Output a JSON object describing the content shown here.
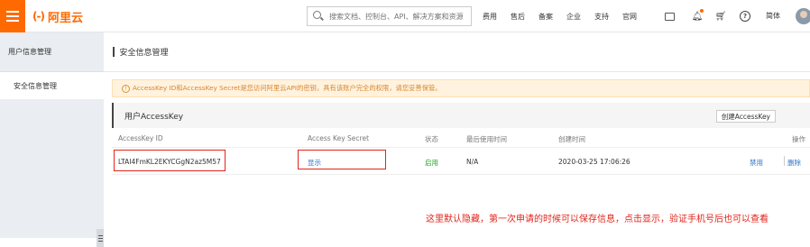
{
  "topbar": {
    "brand": "阿里云",
    "brand_mark": "(-)",
    "search_placeholder": "搜索文档、控制台、API、解决方案和资源",
    "nav": [
      "费用",
      "售后",
      "备案",
      "企业",
      "支持",
      "官网"
    ],
    "lang": "简体",
    "icons": [
      "menu-icon",
      "search-icon",
      "message-icon",
      "bell-icon",
      "cart-icon",
      "help-icon"
    ],
    "accent": "#ff6a00"
  },
  "sidebar": {
    "title": "用户信息管理",
    "items": [
      {
        "label": "安全信息管理",
        "active": true
      }
    ]
  },
  "main": {
    "page_title": "安全信息管理",
    "warning": "AccessKey ID和AccessKey Secret是您访问阿里云API的密钥，具有该账户完全的权限，请您妥善保管。",
    "panel_title": "用户AccessKey",
    "create_button": "创建AccessKey",
    "columns": [
      "AccessKey ID",
      "Access Key Secret",
      "状态",
      "最后使用时间",
      "创建时间",
      "操作"
    ],
    "rows": [
      {
        "access_key_id": "LTAI4FmKL2EKYCGgN2az5M57",
        "secret_action": "显示",
        "status": "启用",
        "last_used": "N/A",
        "created": "2020-03-25 17:06:26",
        "disable": "禁用",
        "delete": "删除"
      }
    ],
    "annotation": "这里默认隐藏，第一次申请的时候可以保存信息，点击显示，验证手机号后也可以查看",
    "annotation_color": "#e1251b"
  }
}
